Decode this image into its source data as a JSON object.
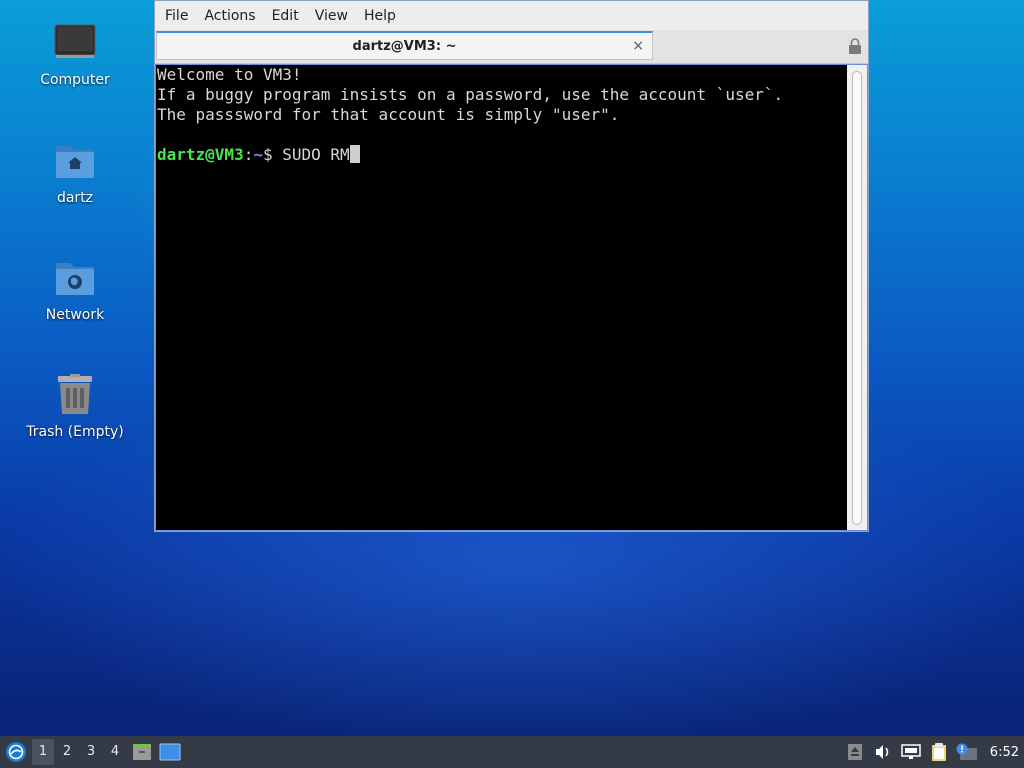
{
  "desktop": {
    "icons": [
      {
        "label": "Computer",
        "icon": "monitor-icon"
      },
      {
        "label": "dartz",
        "icon": "home-folder-icon"
      },
      {
        "label": "Network",
        "icon": "network-folder-icon"
      },
      {
        "label": "Trash (Empty)",
        "icon": "trash-icon"
      }
    ]
  },
  "window": {
    "menu": [
      "File",
      "Actions",
      "Edit",
      "View",
      "Help"
    ],
    "tab_title": "dartz@VM3: ~",
    "tab_close": "×"
  },
  "terminal": {
    "lines": [
      "Welcome to VM3!",
      "If a buggy program insists on a password, use the account `user`.",
      "The passsword for that account is simply \"user\"."
    ],
    "prompt_user": "dartz@VM3",
    "prompt_colon": ":",
    "prompt_path": "~",
    "prompt_symbol": "$ ",
    "command": "SUDO RM"
  },
  "taskbar": {
    "workspaces": [
      "1",
      "2",
      "3",
      "4"
    ],
    "active_workspace": "1",
    "clock": "6:52"
  },
  "colors": {
    "prompt_user": "#4be34b",
    "prompt_path": "#6d8cff",
    "taskbar_bg": "#343b46",
    "tab_accent": "#3c8ee6"
  }
}
